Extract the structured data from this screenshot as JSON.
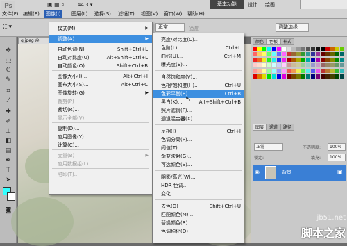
{
  "app": {
    "logo": "Ps",
    "zoom": "44.3",
    "zoom_arrow": "▾"
  },
  "menubar": {
    "items": [
      "文件(F)",
      "编辑(E)",
      "图像(I)",
      "图层(L)",
      "选择(S)",
      "滤镜(T)",
      "视图(V)",
      "窗口(W)",
      "帮助(H)"
    ],
    "workspaces": {
      "active": "基本功能",
      "design": "设计",
      "painting": "绘画"
    }
  },
  "options": {
    "style_value": "正常",
    "opacity_label": "宽度",
    "adjust_edge": "调整边缘..."
  },
  "document": {
    "tab": "q.jpeg @"
  },
  "image_menu": [
    {
      "label": "模式(M)",
      "shortcut": "",
      "submenu": true,
      "disabled": false
    },
    {
      "label": "调整(A)",
      "shortcut": "",
      "submenu": true,
      "disabled": false,
      "highlight": true
    },
    {
      "label": "自动色调(N)",
      "shortcut": "Shift+Ctrl+L",
      "disabled": false
    },
    {
      "label": "自动对比度(U)",
      "shortcut": "Alt+Shift+Ctrl+L",
      "disabled": false
    },
    {
      "label": "自动颜色(O)",
      "shortcut": "Shift+Ctrl+B",
      "disabled": false
    },
    {
      "label": "图像大小(I)...",
      "shortcut": "Alt+Ctrl+I",
      "disabled": false
    },
    {
      "label": "画布大小(S)...",
      "shortcut": "Alt+Ctrl+C",
      "disabled": false
    },
    {
      "label": "图像旋转(G)",
      "shortcut": "",
      "submenu": true,
      "disabled": false
    },
    {
      "label": "裁剪(P)",
      "shortcut": "",
      "disabled": true
    },
    {
      "label": "裁切(R)...",
      "shortcut": "",
      "disabled": false
    },
    {
      "label": "显示全部(V)",
      "shortcut": "",
      "disabled": true
    },
    {
      "label": "复制(D)...",
      "shortcut": "",
      "disabled": false
    },
    {
      "label": "应用图像(Y)...",
      "shortcut": "",
      "disabled": false
    },
    {
      "label": "计算(C)...",
      "shortcut": "",
      "disabled": false
    },
    {
      "label": "变量(B)",
      "shortcut": "",
      "submenu": true,
      "disabled": true
    },
    {
      "label": "应用数据组(L)...",
      "shortcut": "",
      "disabled": true
    },
    {
      "label": "陷印(T)...",
      "shortcut": "",
      "disabled": true
    }
  ],
  "adjust_menu": [
    {
      "label": "亮度/对比度(C)...",
      "shortcut": ""
    },
    {
      "label": "色阶(L)...",
      "shortcut": "Ctrl+L"
    },
    {
      "label": "曲线(U)...",
      "shortcut": "Ctrl+M"
    },
    {
      "label": "曝光度(E)...",
      "shortcut": ""
    },
    {
      "label": "自然饱和度(V)...",
      "shortcut": ""
    },
    {
      "label": "色相/饱和度(H)...",
      "shortcut": "Ctrl+U"
    },
    {
      "label": "色彩平衡(B)...",
      "shortcut": "Ctrl+B",
      "highlight": true
    },
    {
      "label": "黑白(K)...",
      "shortcut": "Alt+Shift+Ctrl+B"
    },
    {
      "label": "照片滤镜(F)...",
      "shortcut": ""
    },
    {
      "label": "通道混合器(X)...",
      "shortcut": ""
    },
    {
      "label": "反相(I)",
      "shortcut": "Ctrl+I"
    },
    {
      "label": "色调分离(P)...",
      "shortcut": ""
    },
    {
      "label": "阈值(T)...",
      "shortcut": ""
    },
    {
      "label": "渐变映射(G)...",
      "shortcut": ""
    },
    {
      "label": "可选颜色(S)...",
      "shortcut": ""
    },
    {
      "label": "阴影/高光(W)...",
      "shortcut": ""
    },
    {
      "label": "HDR 色调...",
      "shortcut": ""
    },
    {
      "label": "变化...",
      "shortcut": ""
    },
    {
      "label": "去色(D)",
      "shortcut": "Shift+Ctrl+U"
    },
    {
      "label": "匹配颜色(M)...",
      "shortcut": ""
    },
    {
      "label": "替换颜色(R)...",
      "shortcut": ""
    },
    {
      "label": "色调均化(Q)",
      "shortcut": ""
    }
  ],
  "panels": {
    "top_tabs": [
      "颜色",
      "色板",
      "样式"
    ],
    "layer_tabs": [
      "图层",
      "通道",
      "路径"
    ],
    "blend_mode": "正常",
    "opacity_label": "不透明度:",
    "opacity_value": "100%",
    "lock_label": "锁定:",
    "fill_label": "填充:",
    "fill_value": "100%",
    "layer_name": "背景"
  },
  "watermark": {
    "site": "jb51.net",
    "brand": "脚本之家"
  },
  "colors": {
    "accent": "#3d8fe0",
    "menu_bg": "#f0f0f0",
    "foreground": "#33ffff",
    "background": "#ffffff"
  }
}
